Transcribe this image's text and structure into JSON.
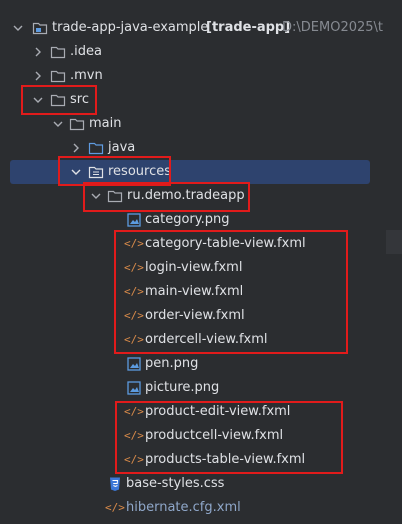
{
  "tree": {
    "root": {
      "name": "trade-app-java-example",
      "module": "[trade-app]",
      "path": "D:\\DEMO2025\\t"
    },
    "idea": ".idea",
    "mvn": ".mvn",
    "src": "src",
    "main": "main",
    "java": "java",
    "resources": "resources",
    "package": "ru.demo.tradeapp",
    "files": [
      "category.png",
      "category-table-view.fxml",
      "login-view.fxml",
      "main-view.fxml",
      "order-view.fxml",
      "ordercell-view.fxml",
      "pen.png",
      "picture.png",
      "product-edit-view.fxml",
      "productcell-view.fxml",
      "products-table-view.fxml"
    ],
    "css": "base-styles.css",
    "hibernate": "hibernate.cfg.xml"
  },
  "colors": {
    "background": "#2b2d30",
    "selection": "#2e436e",
    "highlight_box": "#e11b1b",
    "folder": "#a9acb3",
    "source_folder": "#5f9be0",
    "fxml": "#d98b4a",
    "image": "#5c9be0",
    "css": "#3c78d8"
  },
  "icons": [
    "chevron-down-icon",
    "chevron-right-icon",
    "folder-icon",
    "source-folder-icon",
    "resources-folder-icon",
    "package-icon",
    "image-file-icon",
    "fxml-file-icon",
    "css-file-icon",
    "xml-file-icon"
  ]
}
